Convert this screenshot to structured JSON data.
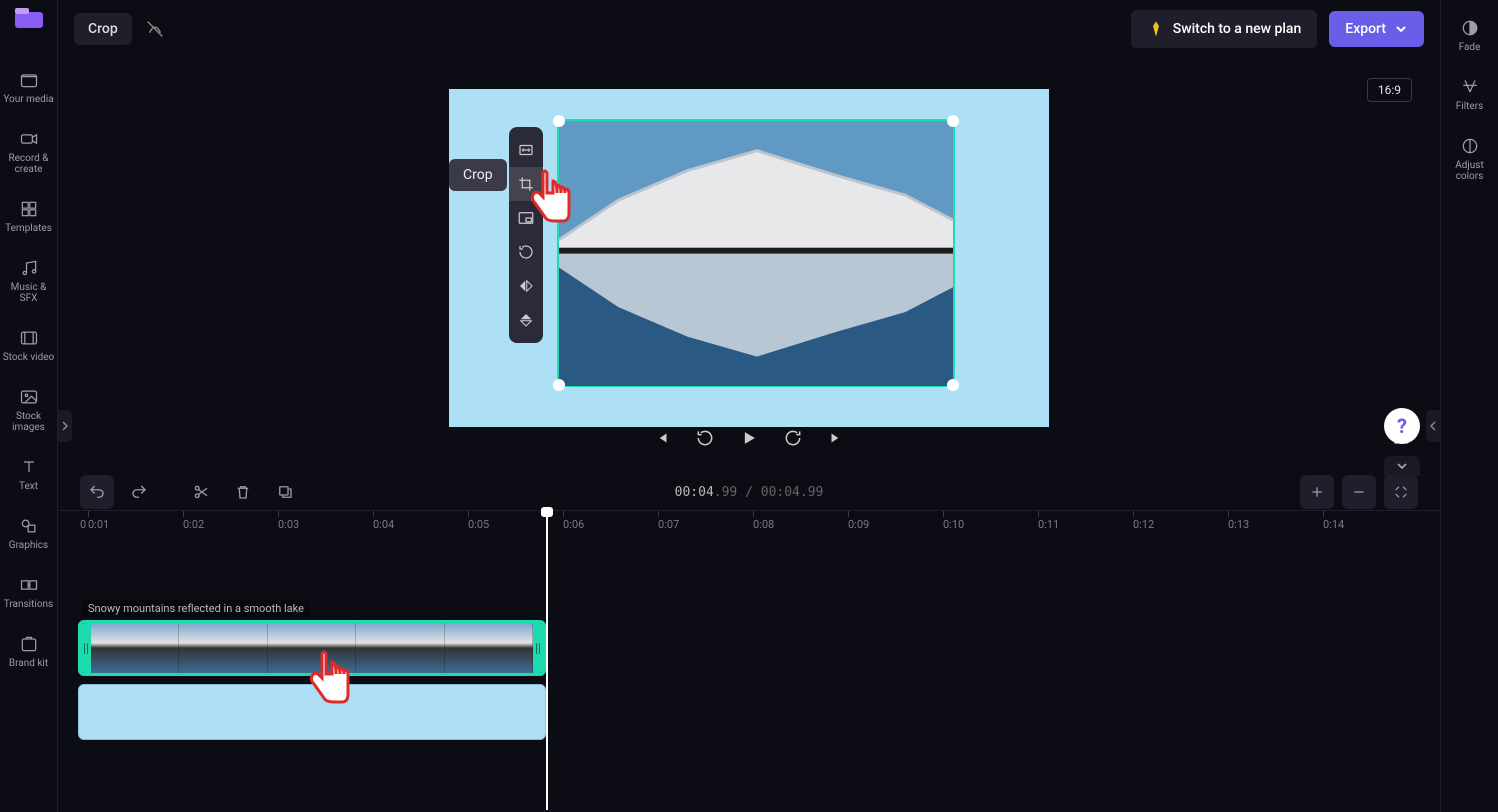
{
  "topbar": {
    "crop_label": "Crop",
    "switch_plan_label": "Switch to a new plan",
    "export_label": "Export"
  },
  "left_sidebar": {
    "items": [
      {
        "label": "Your media"
      },
      {
        "label": "Record & create"
      },
      {
        "label": "Templates"
      },
      {
        "label": "Music & SFX"
      },
      {
        "label": "Stock video"
      },
      {
        "label": "Stock images"
      },
      {
        "label": "Text"
      },
      {
        "label": "Graphics"
      },
      {
        "label": "Transitions"
      },
      {
        "label": "Brand kit"
      }
    ]
  },
  "right_sidebar": {
    "items": [
      {
        "label": "Fade"
      },
      {
        "label": "Filters"
      },
      {
        "label": "Adjust colors"
      }
    ]
  },
  "canvas": {
    "aspect_label": "16:9",
    "crop_tooltip": "Crop"
  },
  "playback": {
    "current": "00:04",
    "current_frac": ".99",
    "total": "00:04",
    "total_frac": ".99"
  },
  "ruler": [
    "0",
    "0:01",
    "0:02",
    "0:03",
    "0:04",
    "0:05",
    "0:06",
    "0:07",
    "0:08",
    "0:09",
    "0:10",
    "0:11",
    "0:12",
    "0:13",
    "0:14"
  ],
  "timeline": {
    "clip_label": "Snowy mountains reflected in a smooth lake"
  },
  "help": "?"
}
